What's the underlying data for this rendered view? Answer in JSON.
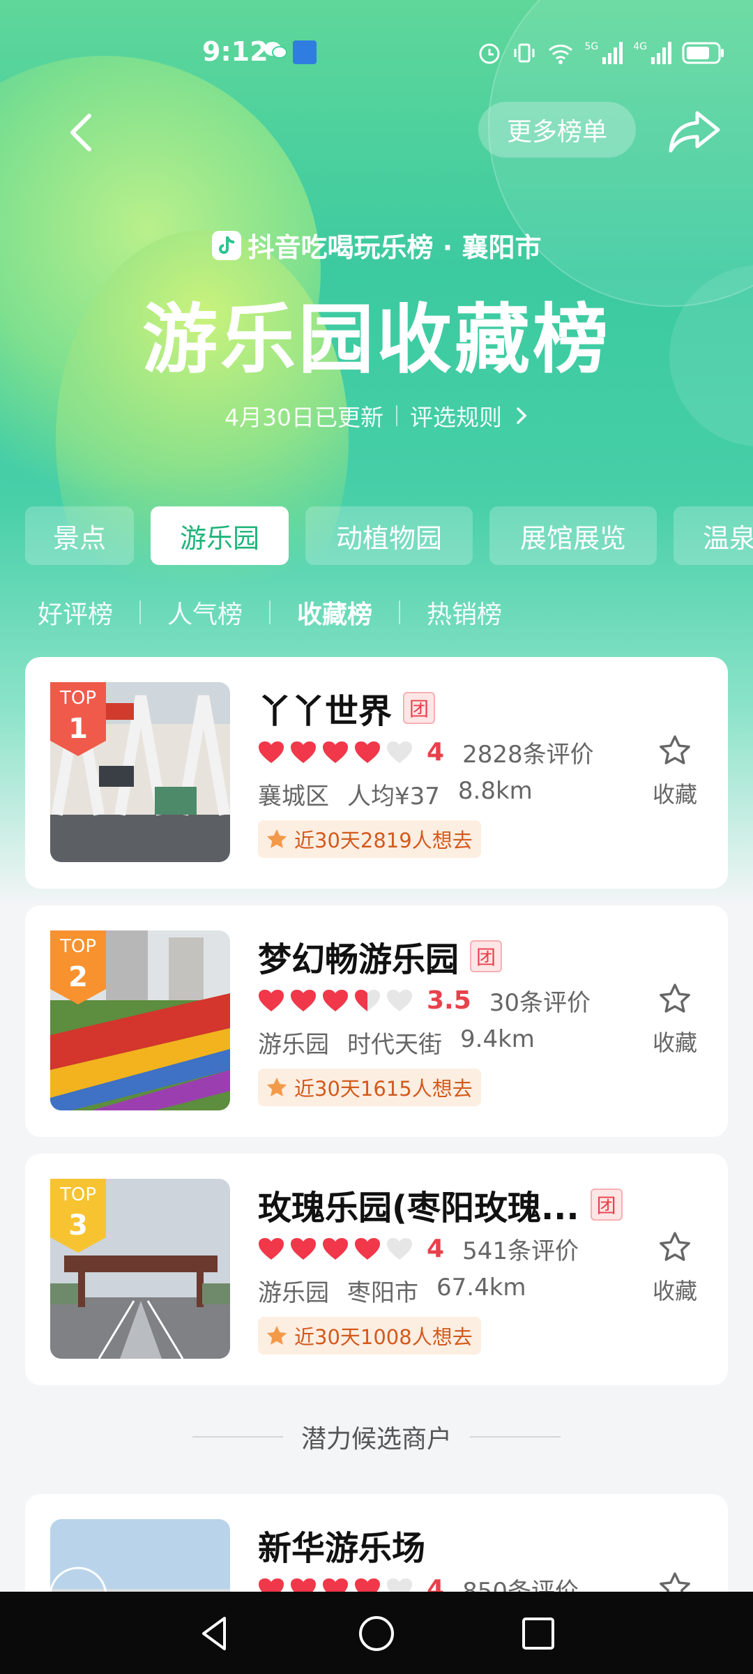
{
  "status_bar": {
    "time": "9:12",
    "network_5g": "5G",
    "network_4g": "4G"
  },
  "nav": {
    "more_label": "更多榜单"
  },
  "header": {
    "brand": "抖音吃喝玩乐榜 · 襄阳市",
    "title": "游乐园收藏榜",
    "updated": "4月30日已更新",
    "rules": "评选规则"
  },
  "category_tabs": [
    {
      "label": "景点",
      "active": false
    },
    {
      "label": "游乐园",
      "active": true
    },
    {
      "label": "动植物园",
      "active": false
    },
    {
      "label": "展馆展览",
      "active": false
    },
    {
      "label": "温泉",
      "active": false
    }
  ],
  "sub_tabs": [
    {
      "label": "好评榜",
      "active": false
    },
    {
      "label": "人气榜",
      "active": false
    },
    {
      "label": "收藏榜",
      "active": true
    },
    {
      "label": "热销榜",
      "active": false
    }
  ],
  "listings": [
    {
      "rank_label": "TOP",
      "rank": "1",
      "name": "丫丫世界",
      "tuan": "团",
      "hearts": 4,
      "score": "4",
      "reviews": "2828条评价",
      "district": "襄城区",
      "price": "人均¥37",
      "distance": "8.8km",
      "hot": "近30天2819人想去",
      "fav_label": "收藏"
    },
    {
      "rank_label": "TOP",
      "rank": "2",
      "name": "梦幻畅游乐园",
      "tuan": "团",
      "hearts": 3.5,
      "score": "3.5",
      "reviews": "30条评价",
      "district": "游乐园",
      "price": "时代天街",
      "distance": "9.4km",
      "hot": "近30天1615人想去",
      "fav_label": "收藏"
    },
    {
      "rank_label": "TOP",
      "rank": "3",
      "name": "玫瑰乐园(枣阳玫瑰...",
      "tuan": "团",
      "hearts": 4,
      "score": "4",
      "reviews": "541条评价",
      "district": "游乐园",
      "price": "枣阳市",
      "distance": "67.4km",
      "hot": "近30天1008人想去",
      "fav_label": "收藏"
    }
  ],
  "potential_label": "潜力候选商户",
  "potential_listings": [
    {
      "name": "新华游乐场",
      "hearts": 4,
      "score": "4",
      "reviews": "850条评价"
    }
  ],
  "colors": {
    "accent_green": "#20b47a",
    "heart_red": "#f0384a",
    "rank1": "#f05a4a",
    "rank2": "#f7922f",
    "rank3": "#f7c331"
  }
}
